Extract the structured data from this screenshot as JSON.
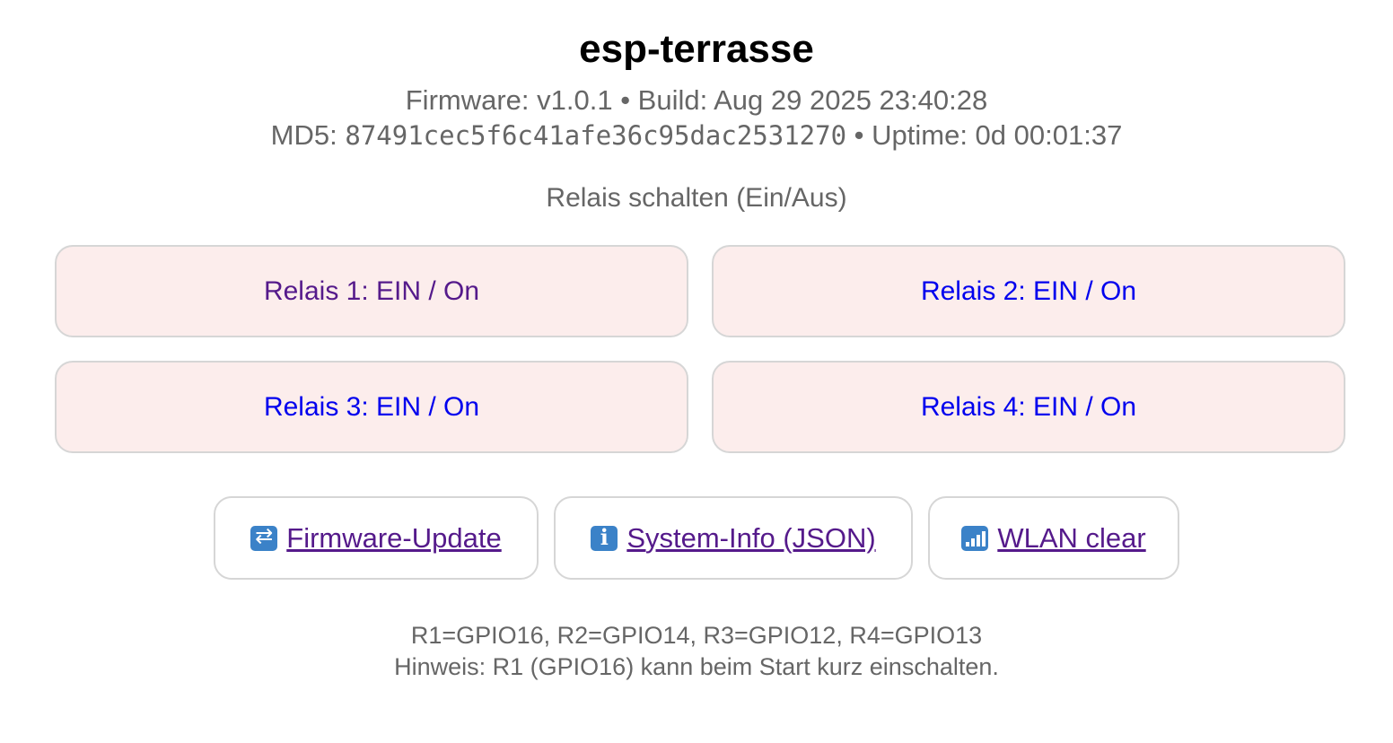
{
  "header": {
    "title": "esp-terrasse",
    "firmware_line": "Firmware: v1.0.1 • Build: Aug 29 2025 23:40:28",
    "md5_label": "MD5: ",
    "md5_value": "87491cec5f6c41afe36c95dac2531270",
    "uptime_text": " • Uptime: 0d 00:01:37"
  },
  "relays": {
    "section_title": "Relais schalten (Ein/Aus)",
    "items": [
      {
        "label": "Relais 1: EIN / On"
      },
      {
        "label": "Relais 2: EIN / On"
      },
      {
        "label": "Relais 3: EIN / On"
      },
      {
        "label": "Relais 4: EIN / On"
      }
    ],
    "background_color": "#fcedec"
  },
  "actions": [
    {
      "label": "Firmware-Update",
      "icon": "repeat-icon"
    },
    {
      "label": "System-Info (JSON)",
      "icon": "info-icon"
    },
    {
      "label": "WLAN clear",
      "icon": "signal-bars-icon"
    }
  ],
  "footer": {
    "pin_map": "R1=GPIO16, R2=GPIO14, R3=GPIO12, R4=GPIO13",
    "hint": "Hinweis: R1 (GPIO16) kann beim Start kurz einschalten."
  },
  "colors": {
    "link": "#0000ee",
    "visited_link": "#551a8b",
    "muted_text": "#666666"
  }
}
